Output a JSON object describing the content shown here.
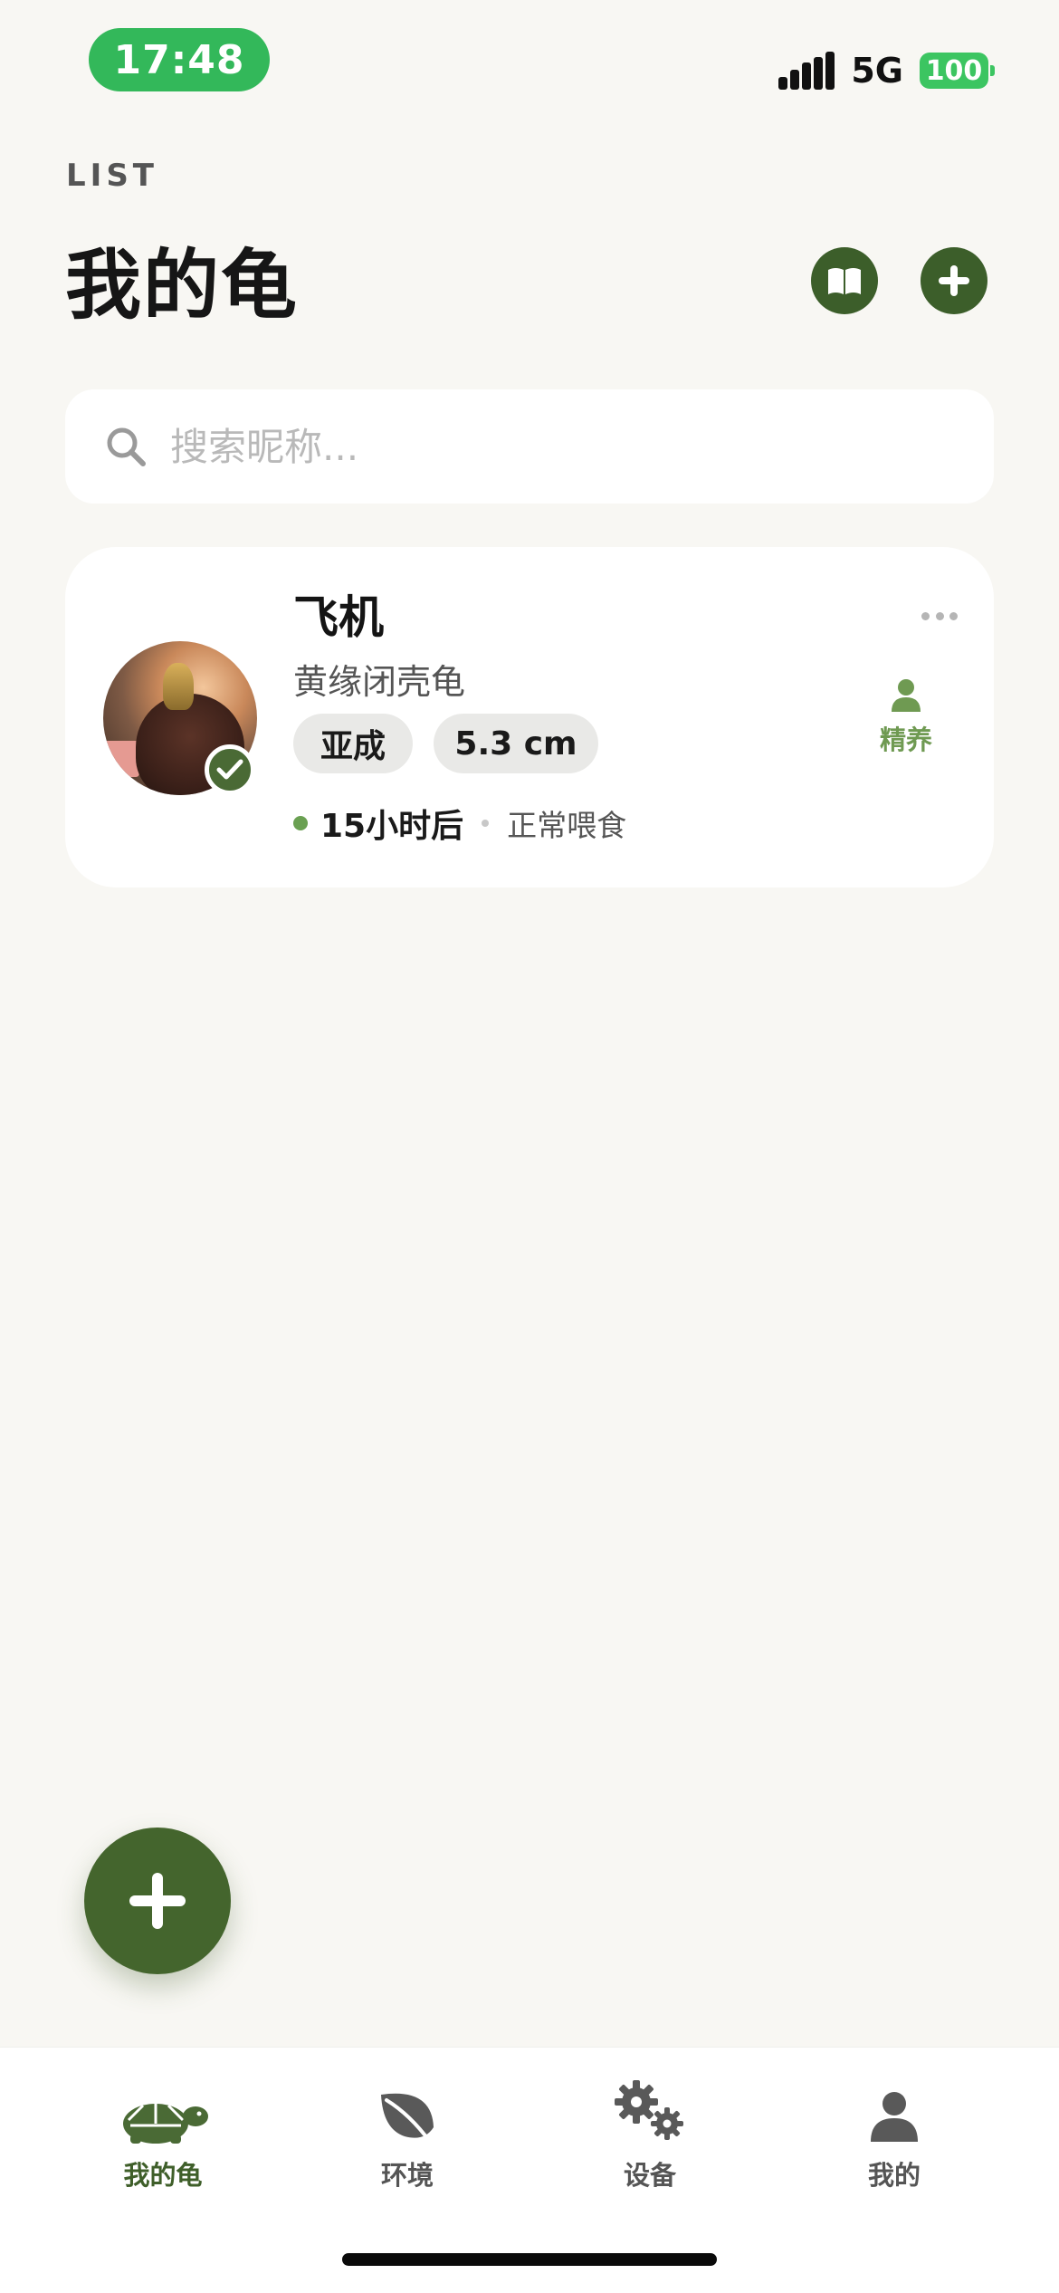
{
  "status_bar": {
    "time": "17:48",
    "network": "5G",
    "battery": "100"
  },
  "header": {
    "eyebrow": "LIST",
    "title": "我的龟",
    "book_button_icon": "book-icon",
    "add_button_icon": "plus-icon"
  },
  "search": {
    "placeholder": "搜索昵称...",
    "value": ""
  },
  "turtles": [
    {
      "name": "飞机",
      "species": "黄缘闭壳龟",
      "stage": "亚成",
      "size": "5.3 cm",
      "next_feed": "15小时后",
      "feed_status": "正常喂食",
      "care_level": "精养",
      "verified": true
    }
  ],
  "tabs": [
    {
      "label": "我的龟",
      "icon": "turtle-icon",
      "active": true
    },
    {
      "label": "环境",
      "icon": "leaf-icon",
      "active": false
    },
    {
      "label": "设备",
      "icon": "gears-icon",
      "active": false
    },
    {
      "label": "我的",
      "icon": "person-icon",
      "active": false
    }
  ],
  "colors": {
    "accent": "#3f5f2a",
    "accent_light": "#6f9a52",
    "time_pill": "#33b85a",
    "battery": "#3cc561",
    "background": "#f8f7f3"
  }
}
